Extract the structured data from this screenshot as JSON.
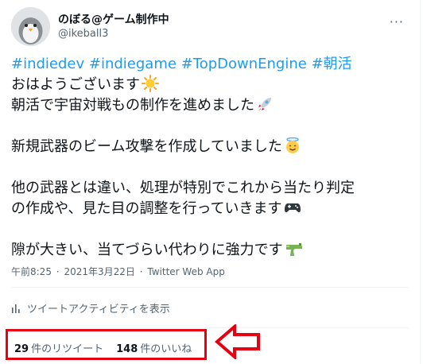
{
  "user": {
    "display_name": "のぼる@ゲーム制作中",
    "handle": "@ikeball3"
  },
  "tweet": {
    "hashtags": [
      "#indiedev",
      "#indiegame",
      "#TopDownEngine",
      "#朝活"
    ],
    "lines": [
      "おはようございます",
      "朝活で宇宙対戦もの制作を進めました",
      "新規武器のビーム攻撃を作成していました",
      "他の武器とは違い、処理が特別でこれから当たり判定",
      "の作成や、見た目の調整を行っていきます",
      "隙が大きい、当てづらい代わりに強力です"
    ],
    "emoji_icons": [
      "sun-emoji",
      "rocket-emoji",
      "halo-face-emoji",
      "gamepad-emoji",
      "water-pistol-emoji"
    ]
  },
  "meta": {
    "time": "午前8:25",
    "separator": "·",
    "date": "2021年3月22日",
    "source": "Twitter Web App"
  },
  "activity": {
    "label": "ツイートアクティビティを表示",
    "icon": "bar-chart-icon"
  },
  "stats": {
    "retweets_count": "29",
    "retweets_label": "件のリツイート",
    "likes_count": "148",
    "likes_label": "件のいいね"
  },
  "annotation": {
    "color": "#e50012"
  },
  "colors": {
    "hashtag": "#1d9bf0",
    "secondary_text": "#536471"
  }
}
